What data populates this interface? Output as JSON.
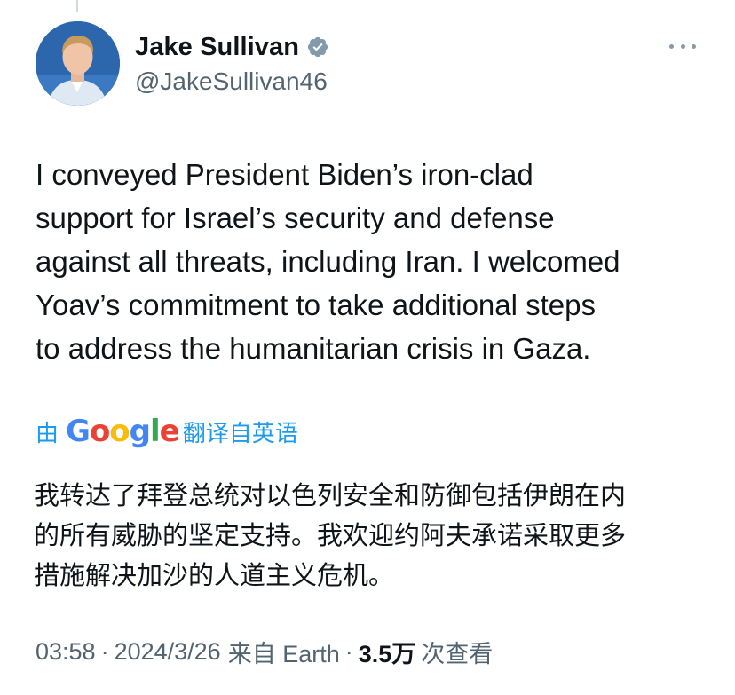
{
  "author": {
    "display_name": "Jake Sullivan",
    "handle": "@JakeSullivan46",
    "verified_color": "#829aab"
  },
  "tweet": {
    "text_lines": [
      "I conveyed President Biden’s iron-clad",
      "support for Israel’s security and defense",
      "against all threats, including Iran.  I welcomed",
      "Yoav’s commitment to take additional steps",
      "to address the humanitarian crisis in Gaza."
    ]
  },
  "translation": {
    "prefix": "由",
    "provider": "Google",
    "suffix": "翻译自英语",
    "link_color": "#1d9bf0",
    "text_lines": [
      "我转达了拜登总统对以色列安全和防御包括伊朗在内",
      "的所有威胁的坚定支持。我欢迎约阿夫承诺采取更多",
      "措施解决加沙的人道主义危机。"
    ]
  },
  "meta": {
    "time": "03:58",
    "separator": "·",
    "date": "2024/3/26",
    "source": "来自 Earth",
    "views_count": "3.5万",
    "views_label": "次查看"
  }
}
